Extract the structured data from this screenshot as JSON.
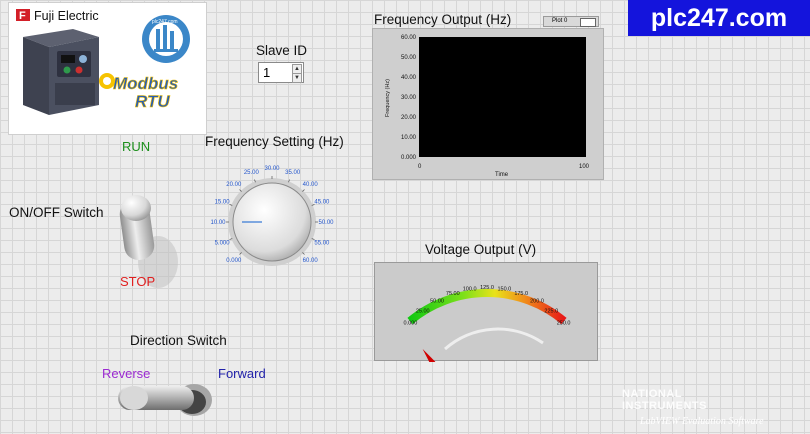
{
  "logo": {
    "fuji_text": "Fuji Electric",
    "fuji_mark": "F",
    "site_small": "plc247.com",
    "modbus_text": "Modbus",
    "rtu_text": "RTU"
  },
  "brand_watermark": "plc247.com",
  "slave_id": {
    "label": "Slave ID",
    "value": "1"
  },
  "run_label": "RUN",
  "stop_label": "STOP",
  "onoff": {
    "label": "ON/OFF Switch",
    "state": "off"
  },
  "frequency_setting": {
    "label": "Frequency Setting (Hz)",
    "value": 10.0,
    "min": 0,
    "max": 60,
    "ticks": [
      "0.000",
      "5.000",
      "10.00",
      "15.00",
      "20.00",
      "25.00",
      "30.00",
      "35.00",
      "40.00",
      "45.00",
      "50.00",
      "55.00",
      "60.00"
    ]
  },
  "direction": {
    "label": "Direction Switch",
    "reverse_label": "Reverse",
    "forward_label": "Forward",
    "state": "reverse"
  },
  "frequency_output": {
    "title": "Frequency Output (Hz)",
    "legend": "Plot 0",
    "ylabel": "Frequency (Hz)",
    "xlabel": "Time",
    "yticks": [
      "60.00",
      "50.00",
      "40.00",
      "30.00",
      "20.00",
      "10.00",
      "0.000"
    ],
    "xticks": [
      "0",
      "100"
    ]
  },
  "voltage_output": {
    "title": "Voltage Output (V)",
    "value": 0,
    "min": 0,
    "max": 250,
    "ticks": [
      "0.000",
      "25.00",
      "50.00",
      "75.00",
      "100.0",
      "125.0",
      "150.0",
      "175.0",
      "200.0",
      "225.0",
      "250.0"
    ]
  },
  "footer": {
    "ni_line1": "NATIONAL",
    "ni_line2": "INSTRUMENTS",
    "ni_eval": "LabVIEW  Evaluation Software"
  },
  "colors": {
    "run": "#1c8f1c",
    "stop": "#e02020",
    "reverse": "#9b2ad1",
    "forward": "#2222aa",
    "watermark_bg": "#1414dc",
    "knob_ticks": "#2255cc"
  }
}
